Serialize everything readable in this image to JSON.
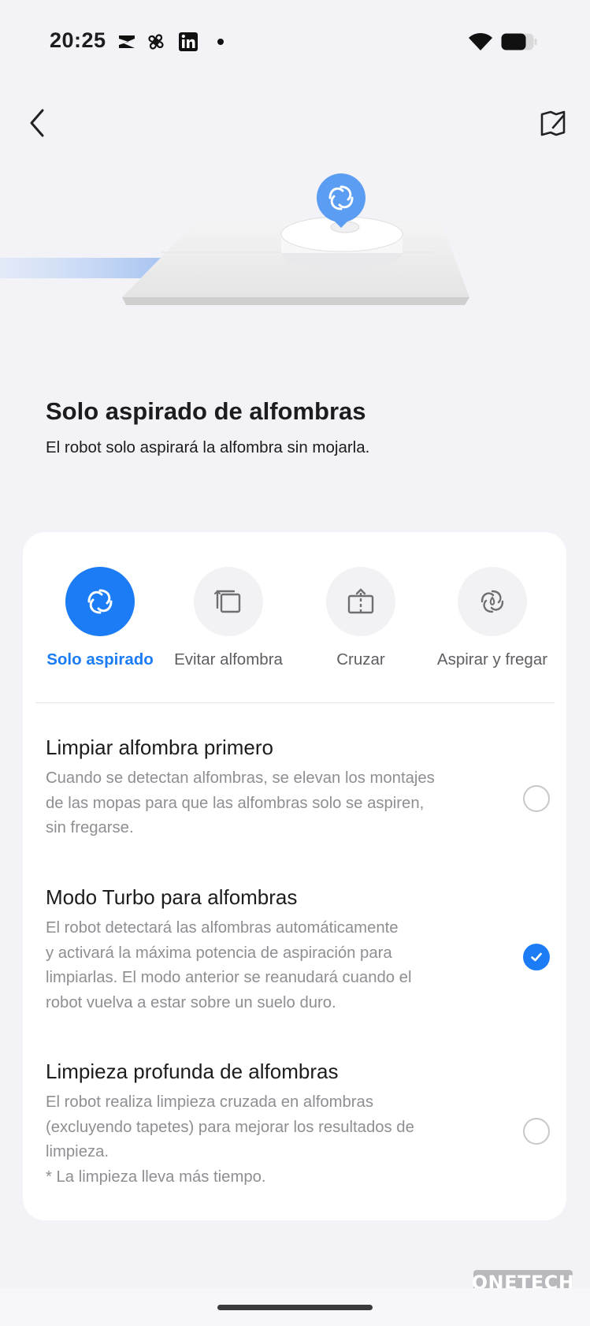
{
  "status_bar": {
    "time": "20:25",
    "app_icons": [
      "capcut-icon",
      "fan-app-icon",
      "linkedin-icon"
    ],
    "battery_level": 0.75
  },
  "header": {
    "back_icon": "back-arrow-icon",
    "edit_map_icon": "map-edit-icon"
  },
  "hero": {
    "title": "Solo aspirado de alfombras",
    "subtitle": "El robot solo aspirará la alfombra sin mojarla."
  },
  "modes": {
    "selected": "Solo aspirado",
    "items": [
      {
        "label": "Solo aspirado",
        "icon": "vacuum-swirl-icon",
        "active": true
      },
      {
        "label": "Evitar alfombra",
        "icon": "avoid-carpet-icon",
        "active": false
      },
      {
        "label": "Cruzar",
        "icon": "cross-carpet-icon",
        "active": false
      },
      {
        "label": "Aspirar y fregar",
        "icon": "vacuum-mop-icon",
        "active": false
      }
    ]
  },
  "options": [
    {
      "title": "Limpiar alfombra primero",
      "description_lines": [
        "Cuando se detectan alfombras, se elevan los montajes",
        "de las mopas para que las alfombras solo se aspiren,",
        "sin fregarse."
      ],
      "checked": false
    },
    {
      "title": "Modo Turbo para alfombras",
      "description_lines": [
        "El robot detectará las alfombras automáticamente",
        "y activará la máxima potencia de aspiración para",
        "limpiarlas. El modo anterior se reanudará cuando el",
        "robot vuelva a estar sobre un suelo duro."
      ],
      "checked": true
    },
    {
      "title": "Limpieza profunda de alfombras",
      "description_lines": [
        "El robot realiza limpieza cruzada en alfombras",
        "(excluyendo tapetes) para mejorar los resultados de",
        "limpieza.",
        "* La limpieza lleva más tiempo."
      ],
      "checked": false
    }
  ],
  "watermark": "ONETECH",
  "colors": {
    "accent": "#1b7cf5",
    "background": "#f2f2f7",
    "card": "#ffffff",
    "secondary_text": "#8e8e93"
  }
}
